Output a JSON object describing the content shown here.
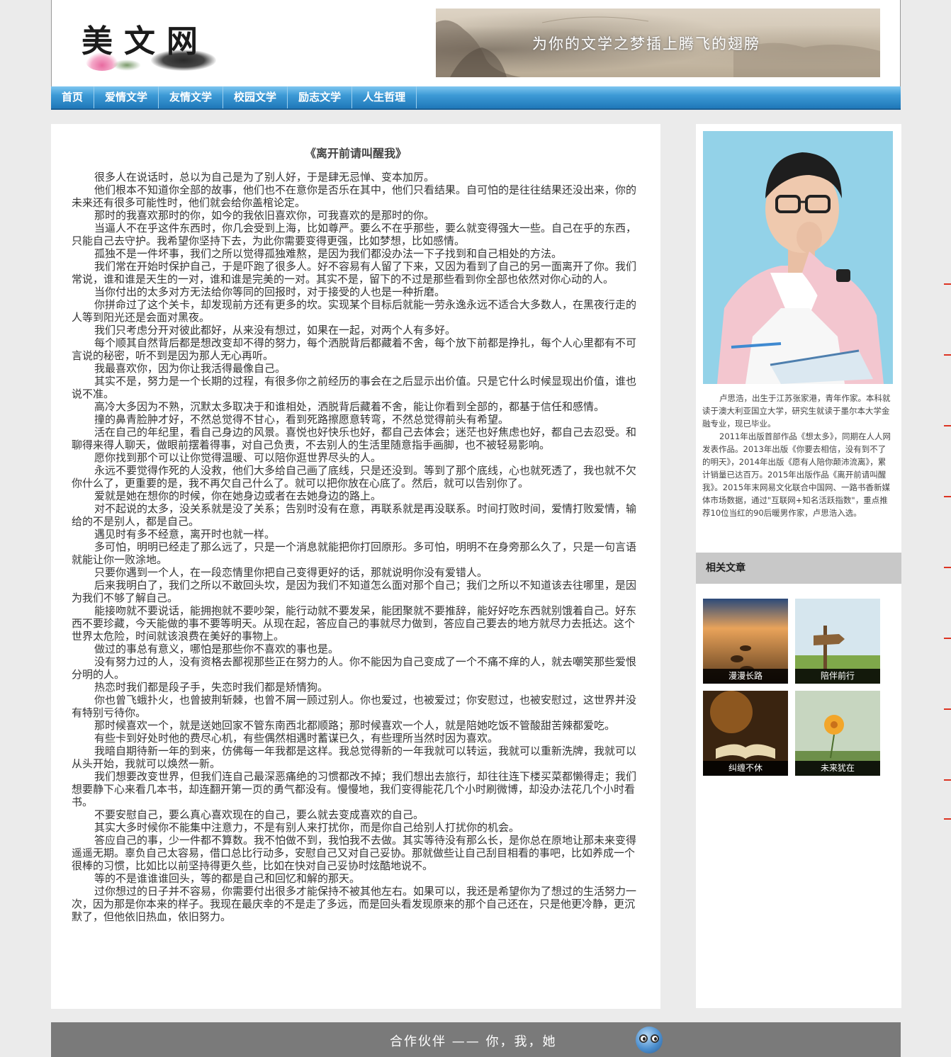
{
  "header": {
    "logo_text": "美文网",
    "banner_text": "为你的文学之梦插上腾飞的翅膀"
  },
  "nav": {
    "items": [
      "首页",
      "爱情文学",
      "友情文学",
      "校园文学",
      "励志文学",
      "人生哲理"
    ]
  },
  "article": {
    "title": "《离开前请叫醒我》",
    "paragraphs": [
      "很多人在说话时，总以为自己是为了别人好，于是肆无忌惮、变本加厉。",
      "他们根本不知道你全部的故事，他们也不在意你是否乐在其中，他们只看结果。自可怕的是往往结果还没出来，你的未来还有很多可能性时，他们就会给你盖棺论定。",
      "那时的我喜欢那时的你，如今的我依旧喜欢你，可我喜欢的是那时的你。",
      "当逼人不在乎这件东西时，你几会受到上海，比如尊严。要么不在乎那些，要么就变得强大一些。自己在乎的东西，只能自己去守护。我希望你坚持下去，为此你需要变得更强，比如梦想，比如感情。",
      "孤独不是一件坏事，我们之所以觉得孤独难熬，是因为我们都没办法一下子找到和自己相处的方法。",
      "我们常在开始时保护自己，于是吓跑了很多人。好不容易有人留了下来，又因为看到了自己的另一面离开了你。我们常说，谁和谁是天生的一对，谁和谁是完美的一对。其实不是，留下的不过是那些看到你全部也依然对你心动的人。",
      "当你付出的太多对方无法给你等同的回报时，对于接受的人也是一种折磨。",
      "你拼命过了这个关卡，却发现前方还有更多的坎。实现某个目标后就能一劳永逸永远不适合大多数人，在黑夜行走的人等到阳光还是会面对黑夜。",
      "我们只考虑分开对彼此都好，从来没有想过，如果在一起，对两个人有多好。",
      "每个顺其自然背后都是想改变却不得的努力，每个洒脱背后都藏着不舍，每个放下前都是挣扎，每个人心里都有不可言说的秘密，听不到是因为那人无心再听。",
      "我最喜欢你，因为你让我活得最像自己。",
      "其实不是，努力是一个长期的过程，有很多你之前经历的事会在之后显示出价值。只是它什么时候显现出价值，谁也说不准。",
      "高冷大多因为不熟，沉默太多取决于和谁相处，洒脱背后藏着不舍，能让你看到全部的，都基于信任和感情。",
      "撞的鼻青脸肿才好，不然总觉得不甘心，看到死路擦愿意转弯，不然总觉得前头有希望。",
      "活在自己的年纪里，看自己身边的风景。喜悦也好快乐也好，都自己去体会；迷茫也好焦虑也好，都自己去忍受。和聊得来得人聊天，做眼前摆着得事，对自己负责，不去别人的生活里随意指手画脚，也不被轻易影响。",
      "愿你找到那个可以让你觉得温暖、可以陪你逛世界尽头的人。",
      "永远不要觉得作死的人没救，他们大多给自己画了底线，只是还没到。等到了那个底线，心也就死透了，我也就不欠你什么了，更重要的是，我不再欠自己什么了。就可以把你放在心底了。然后，就可以告别你了。",
      "爱就是她在想你的时候，你在她身边或者在去她身边的路上。",
      "对不起说的太多，没关系就是没了关系；告别时没有在意，再联系就是再没联系。时间打败时间，爱情打败爱情，输给的不是别人，都是自己。",
      "遇见时有多不经意，离开时也就一样。",
      "多可怕，明明已经走了那么远了，只是一个消息就能把你打回原形。多可怕，明明不在身旁那么久了，只是一句言语就能让你一败涂地。",
      "只要你遇到一个人，在一段恋情里你把自己变得更好的话，那就说明你没有爱错人。",
      "后来我明白了，我们之所以不敢回头坎，是因为我们不知道怎么面对那个自己；我们之所以不知道该去往哪里，是因为我们不够了解自己。",
      "能接吻就不要说话，能拥抱就不要吵架，能行动就不要发呆，能团聚就不要推辞，能好好吃东西就别饿着自己。好东西不要珍藏，今天能做的事不要等明天。从现在起，答应自己的事就尽力做到，答应自己要去的地方就尽力去抵达。这个世界太危险，时间就该浪费在美好的事物上。",
      "做过的事总有意义，哪怕是那些你不喜欢的事也是。",
      "没有努力过的人，没有资格去鄙视那些正在努力的人。你不能因为自己变成了一个不痛不痒的人，就去嘲笑那些爱恨分明的人。",
      "热恋时我们都是段子手，失恋时我们都是矫情狗。",
      "你也曾飞蛾扑火，也曾披荆斩棘，也曾不屑一顾过别人。你也爱过，也被爱过；你安慰过，也被安慰过，这世界并没有特别亏待你。",
      "那时候喜欢一个，就是送她回家不管东南西北都顺路；那时候喜欢一个人，就是陪她吃饭不管酸甜苦辣都爱吃。",
      "有些卡到好处时他的费尽心机，有些偶然相遇时蓄谋已久，有些理所当然时因为喜欢。",
      "我暗自期待新一年的到来，仿佛每一年我都是这样。我总觉得新的一年我就可以转运，我就可以重新洗牌，我就可以从头开始，我就可以焕然一新。",
      "我们想要改变世界，但我们连自己最深恶痛绝的习惯都改不掉；我们想出去旅行，却往往连下楼买菜都懒得走；我们想要静下心来看几本书，却连翻开第一页的勇气都没有。慢慢地，我们变得能花几个小时刷微博，却没办法花几个小时看书。",
      "不要安慰自己，要么真心喜欢现在的自己，要么就去变成喜欢的自己。",
      "其实大多时候你不能集中注意力，不是有别人来打扰你，而是你自己给别人打扰你的机会。",
      "答应自己的事，少一件都不算数。我不怕做不到，我怕我不去做。其实等待没有那么长，是你总在原地让那未来变得遥遥无期。辜负自己太容易，借口总比行动多，安慰自己又对自己妥协。那就做些让自己刮目相看的事吧，比如养成一个很棒的习惯，比如比以前坚持得更久些，比如在快对自己妥协时炫酷地说不。",
      "等的不是谁谁谁回头，等的都是自己和回忆和解的那天。",
      "过你想过的日子并不容易，你需要付出很多才能保持不被其他左右。如果可以，我还是希望你为了想过的生活努力一次，因为那是你本来的样子。我现在最庆幸的不是走了多远，而是回头看发现原来的那个自己还在，只是他更冷静，更沉默了，但他依旧热血，依旧努力。"
    ]
  },
  "sidebar": {
    "bio": [
      "卢思浩，出生于江苏张家港，青年作家。本科就读于澳大利亚国立大学，研究生就读于墨尔本大学金融专业，现已毕业。",
      "2011年出版首部作品《想太多》，同期在人人网发表作品。2013年出版《你要去相信，没有到不了的明天》，2014年出版《愿有人陪你颠沛流离》，累计销量已达百万。2015年出版作品《离开前请叫醒我》。2015年末网易文化联合中国网、一路书香新媒体市场数据，通过\"互联网+知名活跃指数\"，重点推荐10位当红的90后暖男作家，卢思浩入选。"
    ],
    "related_title": "相关文章",
    "related": [
      {
        "caption": "漫漫长路"
      },
      {
        "caption": "陪伴前行"
      },
      {
        "caption": "纠缠不休"
      },
      {
        "caption": "未来犹在"
      }
    ]
  },
  "footer": {
    "text": "合作伙伴 —— 你，我，她"
  }
}
